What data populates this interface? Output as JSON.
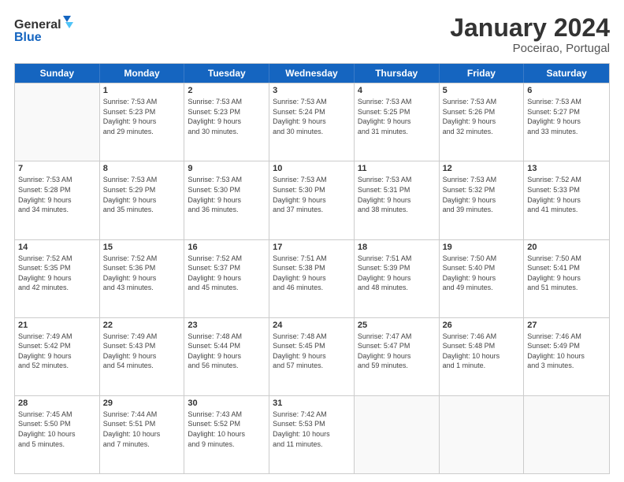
{
  "logo": {
    "line1": "General",
    "line2": "Blue"
  },
  "header": {
    "month": "January 2024",
    "location": "Poceirao, Portugal"
  },
  "days": [
    "Sunday",
    "Monday",
    "Tuesday",
    "Wednesday",
    "Thursday",
    "Friday",
    "Saturday"
  ],
  "weeks": [
    [
      {
        "day": "",
        "info": ""
      },
      {
        "day": "1",
        "info": "Sunrise: 7:53 AM\nSunset: 5:23 PM\nDaylight: 9 hours\nand 29 minutes."
      },
      {
        "day": "2",
        "info": "Sunrise: 7:53 AM\nSunset: 5:23 PM\nDaylight: 9 hours\nand 30 minutes."
      },
      {
        "day": "3",
        "info": "Sunrise: 7:53 AM\nSunset: 5:24 PM\nDaylight: 9 hours\nand 30 minutes."
      },
      {
        "day": "4",
        "info": "Sunrise: 7:53 AM\nSunset: 5:25 PM\nDaylight: 9 hours\nand 31 minutes."
      },
      {
        "day": "5",
        "info": "Sunrise: 7:53 AM\nSunset: 5:26 PM\nDaylight: 9 hours\nand 32 minutes."
      },
      {
        "day": "6",
        "info": "Sunrise: 7:53 AM\nSunset: 5:27 PM\nDaylight: 9 hours\nand 33 minutes."
      }
    ],
    [
      {
        "day": "7",
        "info": "Sunrise: 7:53 AM\nSunset: 5:28 PM\nDaylight: 9 hours\nand 34 minutes."
      },
      {
        "day": "8",
        "info": "Sunrise: 7:53 AM\nSunset: 5:29 PM\nDaylight: 9 hours\nand 35 minutes."
      },
      {
        "day": "9",
        "info": "Sunrise: 7:53 AM\nSunset: 5:30 PM\nDaylight: 9 hours\nand 36 minutes."
      },
      {
        "day": "10",
        "info": "Sunrise: 7:53 AM\nSunset: 5:30 PM\nDaylight: 9 hours\nand 37 minutes."
      },
      {
        "day": "11",
        "info": "Sunrise: 7:53 AM\nSunset: 5:31 PM\nDaylight: 9 hours\nand 38 minutes."
      },
      {
        "day": "12",
        "info": "Sunrise: 7:53 AM\nSunset: 5:32 PM\nDaylight: 9 hours\nand 39 minutes."
      },
      {
        "day": "13",
        "info": "Sunrise: 7:52 AM\nSunset: 5:33 PM\nDaylight: 9 hours\nand 41 minutes."
      }
    ],
    [
      {
        "day": "14",
        "info": "Sunrise: 7:52 AM\nSunset: 5:35 PM\nDaylight: 9 hours\nand 42 minutes."
      },
      {
        "day": "15",
        "info": "Sunrise: 7:52 AM\nSunset: 5:36 PM\nDaylight: 9 hours\nand 43 minutes."
      },
      {
        "day": "16",
        "info": "Sunrise: 7:52 AM\nSunset: 5:37 PM\nDaylight: 9 hours\nand 45 minutes."
      },
      {
        "day": "17",
        "info": "Sunrise: 7:51 AM\nSunset: 5:38 PM\nDaylight: 9 hours\nand 46 minutes."
      },
      {
        "day": "18",
        "info": "Sunrise: 7:51 AM\nSunset: 5:39 PM\nDaylight: 9 hours\nand 48 minutes."
      },
      {
        "day": "19",
        "info": "Sunrise: 7:50 AM\nSunset: 5:40 PM\nDaylight: 9 hours\nand 49 minutes."
      },
      {
        "day": "20",
        "info": "Sunrise: 7:50 AM\nSunset: 5:41 PM\nDaylight: 9 hours\nand 51 minutes."
      }
    ],
    [
      {
        "day": "21",
        "info": "Sunrise: 7:49 AM\nSunset: 5:42 PM\nDaylight: 9 hours\nand 52 minutes."
      },
      {
        "day": "22",
        "info": "Sunrise: 7:49 AM\nSunset: 5:43 PM\nDaylight: 9 hours\nand 54 minutes."
      },
      {
        "day": "23",
        "info": "Sunrise: 7:48 AM\nSunset: 5:44 PM\nDaylight: 9 hours\nand 56 minutes."
      },
      {
        "day": "24",
        "info": "Sunrise: 7:48 AM\nSunset: 5:45 PM\nDaylight: 9 hours\nand 57 minutes."
      },
      {
        "day": "25",
        "info": "Sunrise: 7:47 AM\nSunset: 5:47 PM\nDaylight: 9 hours\nand 59 minutes."
      },
      {
        "day": "26",
        "info": "Sunrise: 7:46 AM\nSunset: 5:48 PM\nDaylight: 10 hours\nand 1 minute."
      },
      {
        "day": "27",
        "info": "Sunrise: 7:46 AM\nSunset: 5:49 PM\nDaylight: 10 hours\nand 3 minutes."
      }
    ],
    [
      {
        "day": "28",
        "info": "Sunrise: 7:45 AM\nSunset: 5:50 PM\nDaylight: 10 hours\nand 5 minutes."
      },
      {
        "day": "29",
        "info": "Sunrise: 7:44 AM\nSunset: 5:51 PM\nDaylight: 10 hours\nand 7 minutes."
      },
      {
        "day": "30",
        "info": "Sunrise: 7:43 AM\nSunset: 5:52 PM\nDaylight: 10 hours\nand 9 minutes."
      },
      {
        "day": "31",
        "info": "Sunrise: 7:42 AM\nSunset: 5:53 PM\nDaylight: 10 hours\nand 11 minutes."
      },
      {
        "day": "",
        "info": ""
      },
      {
        "day": "",
        "info": ""
      },
      {
        "day": "",
        "info": ""
      }
    ]
  ]
}
